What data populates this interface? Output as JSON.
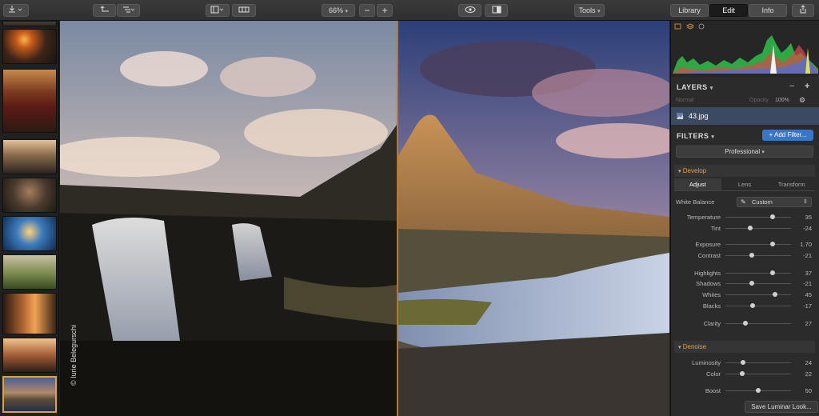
{
  "toolbar": {
    "zoom": "66%",
    "tools_label": "Tools",
    "modes": [
      "Library",
      "Edit",
      "Info"
    ],
    "active_mode": "Edit"
  },
  "viewer": {
    "credit": "© Iurie Belegurschi"
  },
  "panel": {
    "layers_title": "LAYERS",
    "blend_mode": "Normal",
    "opacity_label": "Opacity",
    "opacity_value": "100%",
    "layer_name": "43.jpg",
    "filters_title": "FILTERS",
    "add_filter": "+ Add Filter...",
    "profile": "Professional",
    "develop_title": "Develop",
    "develop_tabs": [
      "Adjust",
      "Lens",
      "Transform"
    ],
    "white_balance_label": "White Balance",
    "white_balance_value": "Custom",
    "develop_sliders": [
      {
        "label": "Temperature",
        "value": "35",
        "pos": 0.72
      },
      {
        "label": "Tint",
        "value": "-24",
        "pos": 0.38
      },
      {
        "label": "Exposure",
        "value": "1.70",
        "pos": 0.72
      },
      {
        "label": "Contrast",
        "value": "-21",
        "pos": 0.4
      },
      {
        "label": "Highlights",
        "value": "37",
        "pos": 0.72
      },
      {
        "label": "Shadows",
        "value": "-21",
        "pos": 0.4
      },
      {
        "label": "Whites",
        "value": "45",
        "pos": 0.75
      },
      {
        "label": "Blacks",
        "value": "-17",
        "pos": 0.41
      },
      {
        "label": "Clarity",
        "value": "27",
        "pos": 0.3
      }
    ],
    "denoise_title": "Denoise",
    "denoise_sliders": [
      {
        "label": "Luminosity",
        "value": "24",
        "pos": 0.27
      },
      {
        "label": "Color",
        "value": "22",
        "pos": 0.26
      },
      {
        "label": "Boost",
        "value": "50",
        "pos": 0.5
      }
    ],
    "save_look": "Save Luminar Look..."
  },
  "filmstrip": {
    "selected_index": 9
  }
}
